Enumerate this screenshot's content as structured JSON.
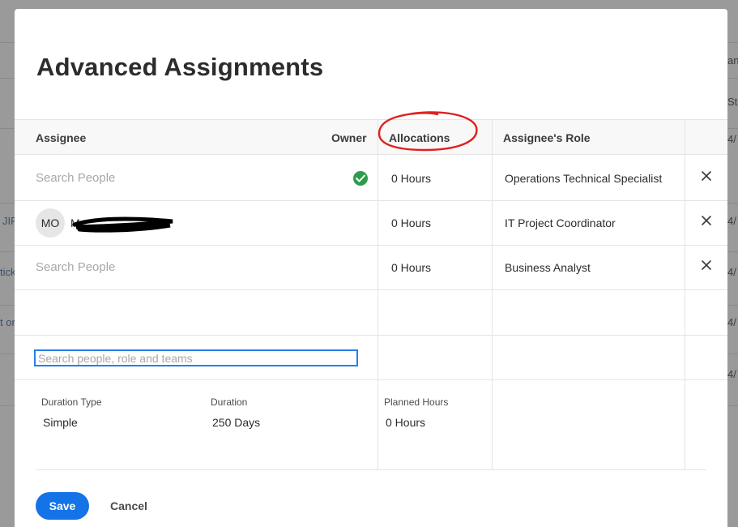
{
  "background": {
    "fragments": [
      "an",
      "Sta",
      "4/",
      "JIR",
      "4/",
      "tick",
      "4/",
      "t or",
      "4/",
      "4/"
    ]
  },
  "modal": {
    "title": "Advanced Assignments",
    "columns": {
      "assignee": "Assignee",
      "owner": "Owner",
      "allocations": "Allocations",
      "role": "Assignee's Role"
    },
    "rows": [
      {
        "assignee_placeholder": "Search People",
        "is_owner": true,
        "allocation": "0 Hours",
        "role": "Operations Technical Specialist"
      },
      {
        "avatar_initials": "MO",
        "assignee_initial": "M",
        "is_owner": false,
        "allocation": "0 Hours",
        "role": "IT Project Coordinator"
      },
      {
        "assignee_placeholder": "Search People",
        "is_owner": false,
        "allocation": "0 Hours",
        "role": "Business Analyst"
      }
    ],
    "add_search": {
      "placeholder": "Search people, role and teams",
      "value": ""
    },
    "details": {
      "duration_type_label": "Duration Type",
      "duration_type_value": "Simple",
      "duration_label": "Duration",
      "duration_value": "250 Days",
      "planned_hours_label": "Planned Hours",
      "planned_hours_value": "0 Hours"
    },
    "actions": {
      "save": "Save",
      "cancel": "Cancel"
    }
  },
  "colors": {
    "primary": "#1473e6",
    "focus": "#2680eb",
    "owner_check": "#2d9d4a",
    "annotation": "#e02020"
  }
}
